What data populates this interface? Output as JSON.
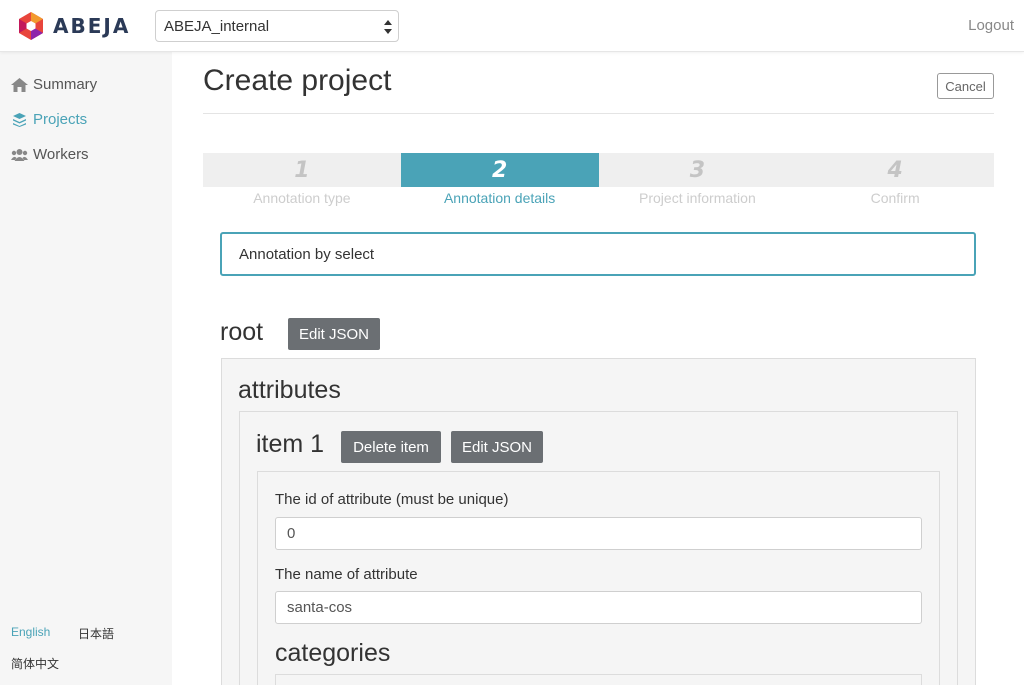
{
  "header": {
    "brand": "ABEJA",
    "org_selected": "ABEJA_internal",
    "logout_label": "Logout"
  },
  "sidebar": {
    "items": [
      {
        "label": "Summary",
        "icon": "home-icon",
        "active": false
      },
      {
        "label": "Projects",
        "icon": "layers-icon",
        "active": true
      },
      {
        "label": "Workers",
        "icon": "users-icon",
        "active": false
      }
    ],
    "languages": [
      "English",
      "日本語",
      "简体中文"
    ],
    "active_language": "English"
  },
  "page": {
    "title": "Create project",
    "cancel_label": "Cancel"
  },
  "steps": [
    {
      "number": "1",
      "label": "Annotation type"
    },
    {
      "number": "2",
      "label": "Annotation details"
    },
    {
      "number": "3",
      "label": "Project information"
    },
    {
      "number": "4",
      "label": "Confirm"
    }
  ],
  "active_step": 2,
  "annotation_type": "Annotation by select",
  "editor": {
    "root_label": "root",
    "edit_json_label": "Edit JSON",
    "attributes_label": "attributes",
    "item_label": "item 1",
    "delete_item_label": "Delete item",
    "id_label": "The id of attribute (must be unique)",
    "id_value": "0",
    "name_label": "The name of attribute",
    "name_value": "santa-cos",
    "categories_label": "categories"
  },
  "colors": {
    "accent": "#4aa3b7",
    "dark_button": "#6b6f73",
    "brand_text": "#2b3a57"
  }
}
